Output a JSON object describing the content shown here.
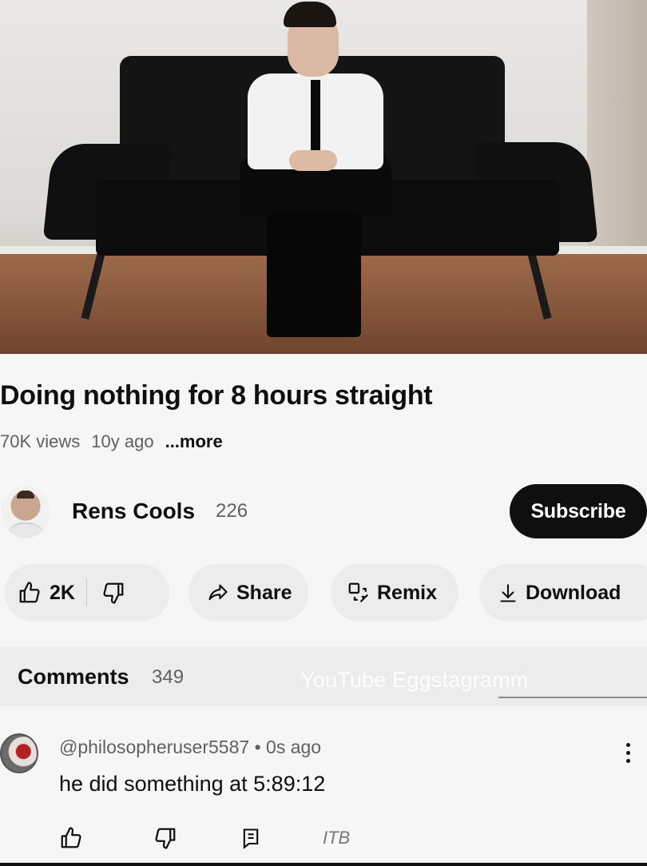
{
  "video": {
    "title": "Doing nothing for 8 hours straight",
    "views": "70K views",
    "age": "10y ago",
    "more": "...more"
  },
  "channel": {
    "name": "Rens Cools",
    "subscribers": "226",
    "subscribe_label": "Subscribe"
  },
  "actions": {
    "likes": "2K",
    "share": "Share",
    "remix": "Remix",
    "download": "Download"
  },
  "comments": {
    "title": "Comments",
    "count": "349",
    "watermark": "YouTube Eggstagramm",
    "top_comment": {
      "author": "@philosopheruser5587",
      "separator": "•",
      "age": "0s ago",
      "text": "he did something at 5:89:12"
    },
    "itb": "ITB"
  },
  "icons": {
    "like": "thumbs-up-icon",
    "dislike": "thumbs-down-icon",
    "share": "share-arrow-icon",
    "remix": "remix-icon",
    "download": "download-icon",
    "reply": "reply-icon",
    "more": "more-vertical-icon"
  },
  "colors": {
    "subscribe_bg": "#0f0f0f",
    "pill_bg": "#ececec",
    "secondary_text": "#606060"
  }
}
